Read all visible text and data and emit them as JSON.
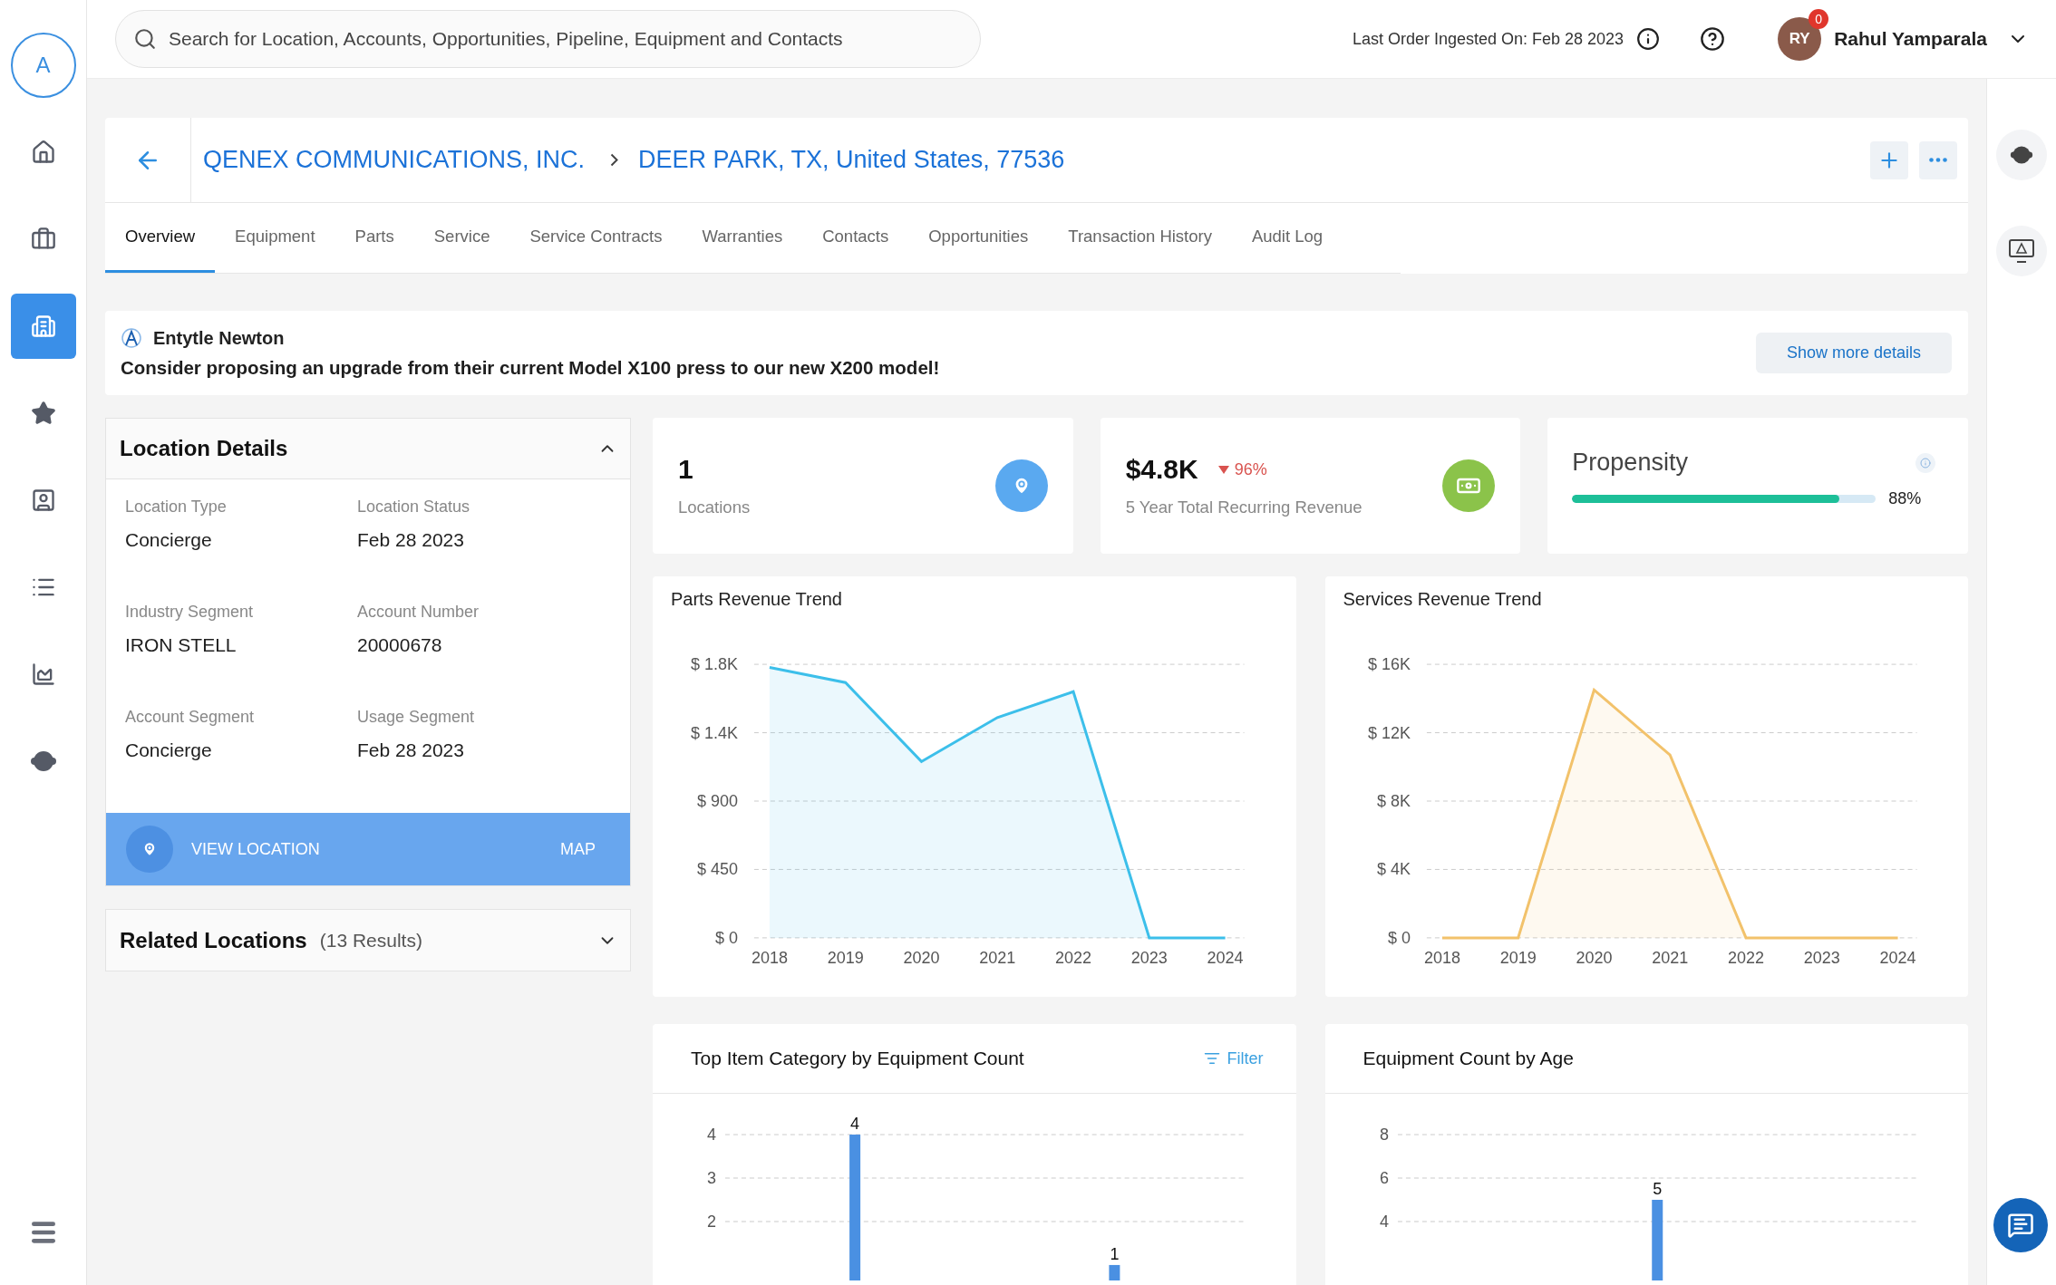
{
  "sidebar": {
    "avatar": "A",
    "items": [
      {
        "selected": false
      },
      {
        "selected": false
      },
      {
        "selected": true
      },
      {
        "selected": false
      },
      {
        "selected": false
      },
      {
        "selected": false
      },
      {
        "selected": false
      },
      {
        "selected": false
      }
    ]
  },
  "topbar": {
    "search": {
      "placeholder": "Search for Location, Accounts, Opportunities, Pipeline, Equipment and Contacts"
    },
    "last_order": "Last Order Ingested On: Feb 28 2023",
    "user": {
      "initials": "RY",
      "badge": "0",
      "name": "Rahul Yamparala"
    }
  },
  "breadcrumb": [
    "QENEX COMMUNICATIONS, INC.",
    "DEER PARK, TX, United States, 77536"
  ],
  "tabs": [
    {
      "label": "Overview",
      "selected": true
    },
    {
      "label": "Equipment",
      "selected": false
    },
    {
      "label": "Parts",
      "selected": false
    },
    {
      "label": "Service",
      "selected": false
    },
    {
      "label": "Service Contracts",
      "selected": false
    },
    {
      "label": "Warranties",
      "selected": false
    },
    {
      "label": "Contacts",
      "selected": false
    },
    {
      "label": "Opportunities",
      "selected": false
    },
    {
      "label": "Transaction History",
      "selected": false
    },
    {
      "label": "Audit Log",
      "selected": false
    }
  ],
  "insight": {
    "author": "Entytle Newton",
    "message": "Consider proposing an upgrade from their current Model X100 press to our new X200 model!",
    "button": "Show more details"
  },
  "location_details": {
    "title": "Location Details",
    "expanded": true,
    "fields": [
      {
        "label": "Location Type",
        "value": "Concierge"
      },
      {
        "label": "Location Status",
        "value": "Feb 28 2023"
      },
      {
        "label": "Industry Segment",
        "value": "IRON STELL"
      },
      {
        "label": "Account Number",
        "value": "20000678"
      },
      {
        "label": "Account Segment",
        "value": "Concierge"
      },
      {
        "label": "Usage Segment",
        "value": "Feb 28 2023"
      }
    ],
    "view_location": "VIEW LOCATION",
    "map": "MAP"
  },
  "related_locations": {
    "title": "Related Locations",
    "count": "(13 Results)",
    "expanded": false
  },
  "stats": [
    {
      "kind": "count",
      "value": "1",
      "label": "Locations"
    },
    {
      "kind": "revenue",
      "value": "$4.8K",
      "decrease": true,
      "change": "96%",
      "label": "5 Year Total Recurring Revenue"
    },
    {
      "kind": "propensity",
      "title": "Propensity",
      "level": 0.88,
      "reading": "88%"
    }
  ],
  "trend_charts": [
    {
      "title": "Parts Revenue Trend",
      "chart_data": {
        "type": "area",
        "grid": true,
        "ylim": [
          0,
          1800
        ],
        "categories": [
          "2018",
          "2019",
          "2020",
          "2021",
          "2022",
          "2023",
          "2024"
        ],
        "yticks": [
          {
            "value": 0,
            "label": "$ 0"
          },
          {
            "value": 450,
            "label": "$ 450"
          },
          {
            "value": 900,
            "label": "$ 900"
          },
          {
            "value": 1350,
            "label": "$ 1.4K"
          },
          {
            "value": 1800,
            "label": "$ 1.8K"
          }
        ],
        "series": [
          {
            "color": "#3cbfea",
            "values": [
              1780,
              1680,
              1160,
              1450,
              1620,
              0,
              0
            ]
          }
        ]
      }
    },
    {
      "title": "Services Revenue Trend",
      "chart_data": {
        "type": "area",
        "grid": true,
        "ylim": [
          0,
          16000
        ],
        "categories": [
          "2018",
          "2019",
          "2020",
          "2021",
          "2022",
          "2023",
          "2024"
        ],
        "yticks": [
          {
            "value": 0,
            "label": "$ 0"
          },
          {
            "value": 4000,
            "label": "$ 4K"
          },
          {
            "value": 8000,
            "label": "$ 8K"
          },
          {
            "value": 12000,
            "label": "$ 12K"
          },
          {
            "value": 16000,
            "label": "$ 16K"
          }
        ],
        "series": [
          {
            "color": "#f2c26b",
            "values": [
              0,
              0,
              14500,
              10700,
              0,
              0,
              0
            ]
          }
        ]
      }
    }
  ],
  "bar_charts": [
    {
      "title": "Top Item Category by Equipment Count",
      "filter": "Filter",
      "chart_data": {
        "type": "bar",
        "grid": true,
        "ylim": [
          0,
          4
        ],
        "values": [
          4,
          1
        ],
        "yticks": [
          2,
          3,
          4
        ],
        "data_labels": true
      }
    },
    {
      "title": "Equipment Count by Age",
      "chart_data": {
        "type": "bar",
        "grid": true,
        "ylim": [
          0,
          8
        ],
        "values": [
          5
        ],
        "yticks": [
          4,
          6,
          8
        ],
        "data_labels": true
      }
    }
  ]
}
